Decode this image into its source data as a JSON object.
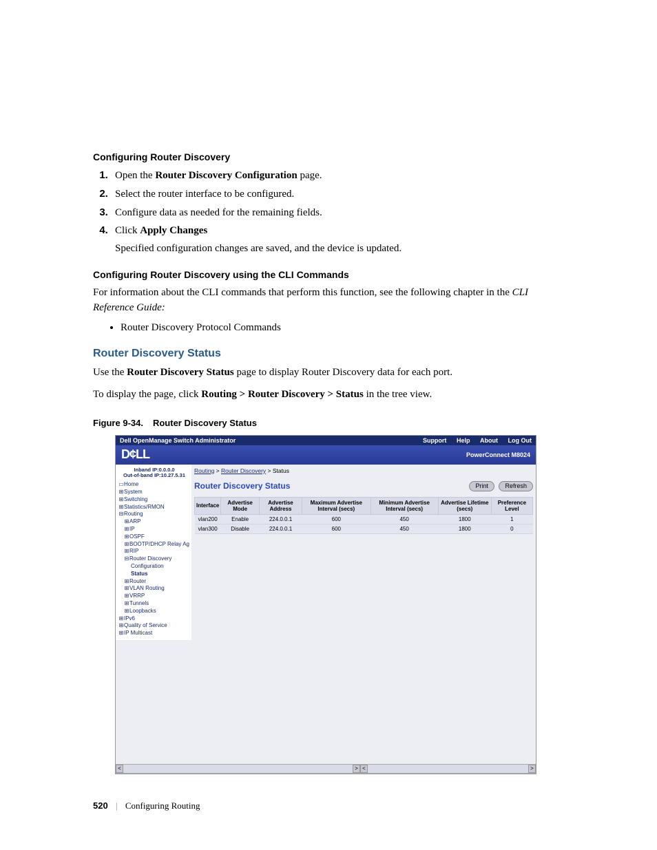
{
  "headings": {
    "configRD": "Configuring Router Discovery",
    "configRD_cli": "Configuring Router Discovery using the CLI Commands",
    "rdStatus": "Router Discovery Status",
    "figCaption_num": "Figure 9-34.",
    "figCaption_title": "Router Discovery Status"
  },
  "steps": {
    "s1_pre": "Open the ",
    "s1_bold": "Router Discovery Configuration",
    "s1_post": " page.",
    "s2": "Select the router interface to be configured.",
    "s3": "Configure data as needed for the remaining fields.",
    "s4_pre": "Click ",
    "s4_bold": "Apply Changes",
    "s4_post_line": "Specified configuration changes are saved, and the device is updated."
  },
  "cli_para": {
    "pre": "For information about the CLI commands that perform this function, see the following chapter in the ",
    "italic": "CLI Reference Guide:"
  },
  "bullets": {
    "rdp": "Router Discovery Protocol Commands"
  },
  "rds_paras": {
    "p1_pre": "Use the ",
    "p1_bold": "Router Discovery Status",
    "p1_post": " page to display Router Discovery data for each port.",
    "p2_pre": "To display the page, click ",
    "p2_bold": "Routing > Router Discovery > Status",
    "p2_post": " in the tree view."
  },
  "shot": {
    "topbar_title": "Dell OpenManage Switch Administrator",
    "links": {
      "support": "Support",
      "help": "Help",
      "about": "About",
      "logout": "Log Out"
    },
    "logo": "D¢LL",
    "product": "PowerConnect M8024",
    "ip1": "Inband IP:0.0.0.0",
    "ip2": "Out-of-band IP:10.27.5.31",
    "tree": {
      "home": "Home",
      "system": "System",
      "switching": "Switching",
      "stats": "Statistics/RMON",
      "routing": "Routing",
      "arp": "ARP",
      "ip": "IP",
      "ospf": "OSPF",
      "bootp": "BOOTP/DHCP Relay Ag",
      "rip": "RIP",
      "rd": "Router Discovery",
      "rdconf": "Configuration",
      "rdstatus": "Status",
      "router": "Router",
      "vlanr": "VLAN Routing",
      "vrrp": "VRRP",
      "tunnels": "Tunnels",
      "loop": "Loopbacks",
      "ipv6": "IPv6",
      "qos": "Quality of Service",
      "ipm": "IP Multicast"
    },
    "crumb": {
      "routing": "Routing",
      "rd": "Router Discovery",
      "status": "Status"
    },
    "panel_title": "Router Discovery Status",
    "btn_print": "Print",
    "btn_refresh": "Refresh",
    "th": {
      "iface": "Interface",
      "mode": "Advertise Mode",
      "addr": "Advertise Address",
      "max": "Maximum Advertise Interval (secs)",
      "min": "Minimum Advertise Interval (secs)",
      "life": "Advertise Lifetime (secs)",
      "pref": "Preference Level"
    },
    "rows": [
      {
        "iface": "vlan200",
        "mode": "Enable",
        "addr": "224.0.0.1",
        "max": "600",
        "min": "450",
        "life": "1800",
        "pref": "1"
      },
      {
        "iface": "vlan300",
        "mode": "Disable",
        "addr": "224.0.0.1",
        "max": "600",
        "min": "450",
        "life": "1800",
        "pref": "0"
      }
    ]
  },
  "footer": {
    "page": "520",
    "section": "Configuring Routing"
  }
}
